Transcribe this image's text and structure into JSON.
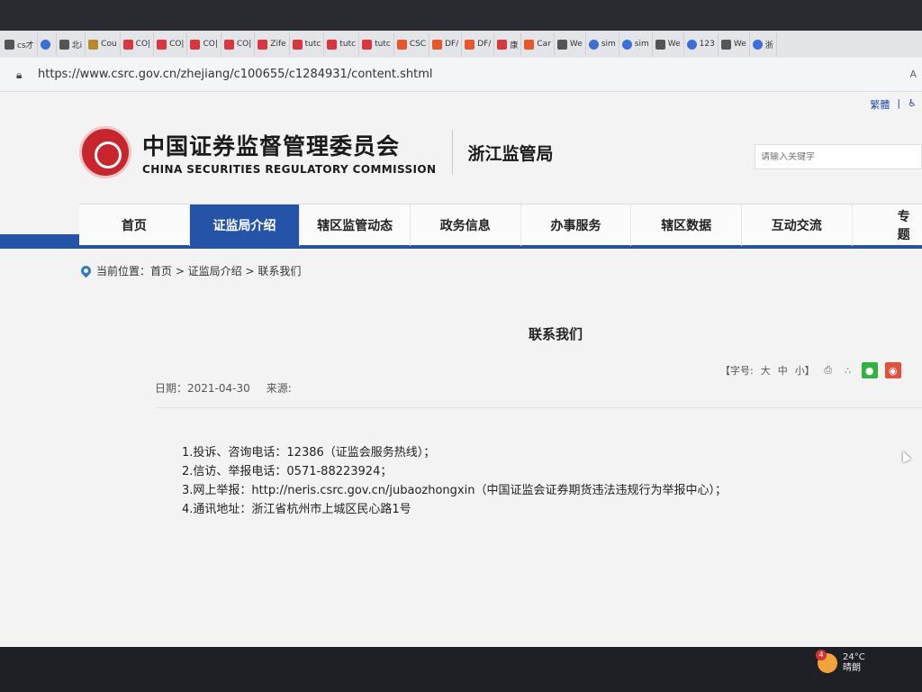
{
  "tabs": [
    {
      "label": "cs才",
      "fav": "grey"
    },
    {
      "label": "",
      "fav": "blue"
    },
    {
      "label": "北i",
      "fav": "grey"
    },
    {
      "label": "Cou",
      "fav": "gold"
    },
    {
      "label": "CO|",
      "fav": "red"
    },
    {
      "label": "CO|",
      "fav": "red"
    },
    {
      "label": "CO|",
      "fav": "red"
    },
    {
      "label": "CO|",
      "fav": "red"
    },
    {
      "label": "Zife",
      "fav": "red"
    },
    {
      "label": "tutc",
      "fav": "red"
    },
    {
      "label": "tutc",
      "fav": "red"
    },
    {
      "label": "tutc",
      "fav": "red"
    },
    {
      "label": "CSC",
      "fav": "orange"
    },
    {
      "label": "DF/",
      "fav": "orange"
    },
    {
      "label": "DF/",
      "fav": "orange"
    },
    {
      "label": "康",
      "fav": "red"
    },
    {
      "label": "Car",
      "fav": "orange"
    },
    {
      "label": "We",
      "fav": "grey"
    },
    {
      "label": "sim",
      "fav": "blue"
    },
    {
      "label": "sim",
      "fav": "blue"
    },
    {
      "label": "We",
      "fav": "grey"
    },
    {
      "label": "123",
      "fav": "blue"
    },
    {
      "label": "We",
      "fav": "grey"
    },
    {
      "label": "浙",
      "fav": "blue"
    }
  ],
  "address": {
    "url": "https://www.csrc.gov.cn/zhejiang/c100655/c1284931/content.shtml",
    "right": "A"
  },
  "header": {
    "toplinks": [
      "繁體",
      "|"
    ],
    "cn_title": "中国证券监督管理委员会",
    "en_title": "CHINA SECURITIES REGULATORY COMMISSION",
    "bureau": "浙江监管局",
    "search_placeholder": "请输入关键字"
  },
  "nav": {
    "items": [
      "首页",
      "证监局介绍",
      "辖区监管动态",
      "政务信息",
      "办事服务",
      "辖区数据",
      "互动交流",
      "专题"
    ],
    "active_index": 1
  },
  "breadcrumb": "当前位置：首页 > 证监局介绍 > 联系我们",
  "article": {
    "title": "联系我们",
    "font_label": "【字号:",
    "font_big": "大",
    "font_mid": "中",
    "font_small": "小】",
    "date": "日期：2021-04-30",
    "source": "来源:",
    "lines": [
      "1.投诉、咨询电话：12386（证监会服务热线）；",
      "2.信访、举报电话：0571-88223924；",
      "3.网上举报：http://neris.csrc.gov.cn/jubaozhongxin（中国证监会证券期货违法违规行为举报中心）；",
      "4.通讯地址：浙江省杭州市上城区民心路1号"
    ]
  },
  "taskbar": {
    "badge": "4",
    "temp": "24°C",
    "weather": "晴朗"
  },
  "colors": {
    "brand_blue": "#2553a8",
    "logo_red": "#c9252c"
  }
}
